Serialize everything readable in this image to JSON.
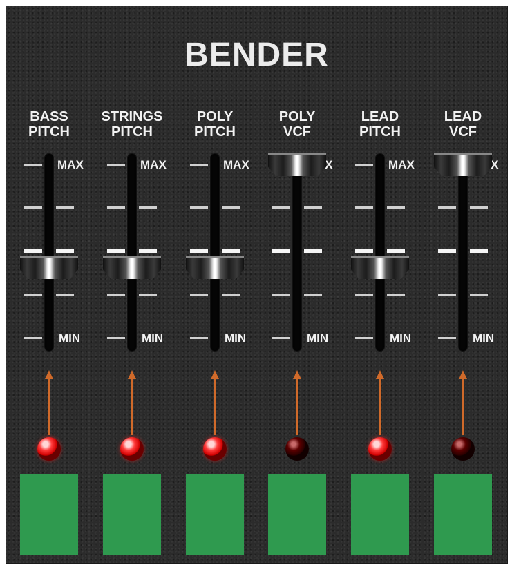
{
  "panel": {
    "title": "BENDER"
  },
  "scale": {
    "max": "MAX",
    "min": "MIN"
  },
  "channels": [
    {
      "label1": "BASS",
      "label2": "PITCH",
      "position": 0.5,
      "led_on": true,
      "max_text": "MAX",
      "min_text": "MIN"
    },
    {
      "label1": "STRINGS",
      "label2": "PITCH",
      "position": 0.5,
      "led_on": true,
      "max_text": "MAX",
      "min_text": "MIN"
    },
    {
      "label1": "POLY",
      "label2": "PITCH",
      "position": 0.5,
      "led_on": true,
      "max_text": "MAX",
      "min_text": "MIN"
    },
    {
      "label1": "POLY",
      "label2": "VCF",
      "position": 1.0,
      "led_on": false,
      "max_text": "AX",
      "min_text": "MIN"
    },
    {
      "label1": "LEAD",
      "label2": "PITCH",
      "position": 0.5,
      "led_on": true,
      "max_text": "MAX",
      "min_text": "MIN"
    },
    {
      "label1": "LEAD",
      "label2": "VCF",
      "position": 1.0,
      "led_on": false,
      "max_text": "AX",
      "min_text": "MIN"
    }
  ],
  "colors": {
    "panel": "#2b2b2b",
    "arrow": "#d06a2a",
    "led_on": "#ff2a2a",
    "led_off": "#5a0000",
    "pad": "#2f9a4f"
  }
}
